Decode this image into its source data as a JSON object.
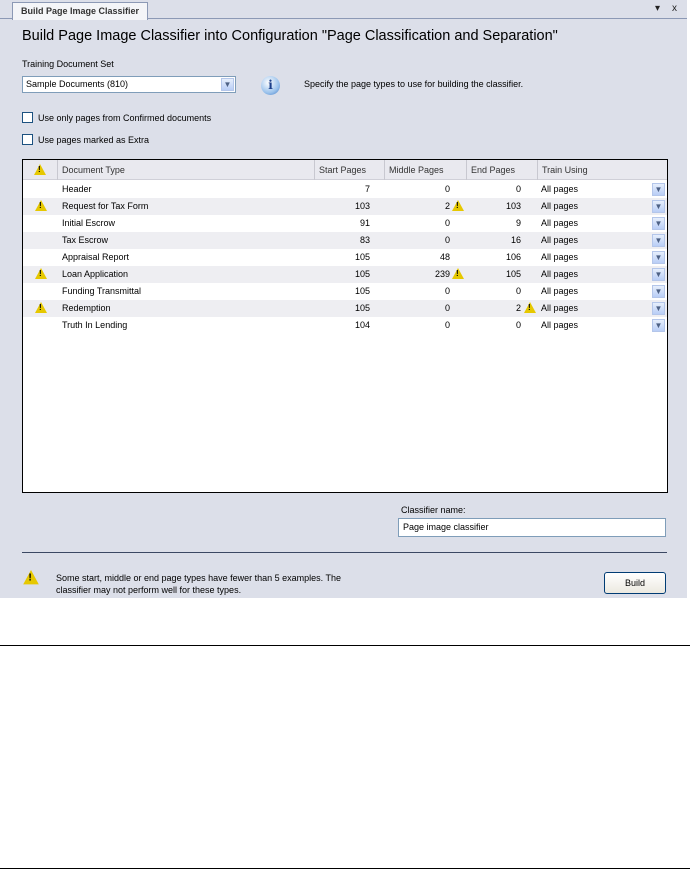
{
  "tab": {
    "label": "Build Page Image Classifier",
    "pin": "▾",
    "close": "x"
  },
  "title": "Build Page Image Classifier into Configuration \"Page Classification and Separation\"",
  "training_set": {
    "label": "Training Document Set",
    "value": "Sample Documents (810)"
  },
  "info_text": "Specify the page types to use for building the classifier.",
  "options": {
    "confirmed": "Use only pages from Confirmed documents",
    "extra": "Use pages marked as Extra"
  },
  "table": {
    "headers": [
      "Document Type",
      "Start Pages",
      "Middle Pages",
      "End Pages",
      "Train Using"
    ],
    "rows": [
      {
        "warn": false,
        "type": "Header",
        "start": "7",
        "middle": "0",
        "middle_warn": false,
        "end": "0",
        "end_warn": false,
        "train": "All pages"
      },
      {
        "warn": true,
        "type": "Request for Tax Form",
        "start": "103",
        "middle": "2",
        "middle_warn": true,
        "end": "103",
        "end_warn": false,
        "train": "All pages"
      },
      {
        "warn": false,
        "type": "Initial Escrow",
        "start": "91",
        "middle": "0",
        "middle_warn": false,
        "end": "9",
        "end_warn": false,
        "train": "All pages"
      },
      {
        "warn": false,
        "type": "Tax Escrow",
        "start": "83",
        "middle": "0",
        "middle_warn": false,
        "end": "16",
        "end_warn": false,
        "train": "All pages"
      },
      {
        "warn": false,
        "type": "Appraisal Report",
        "start": "105",
        "middle": "48",
        "middle_warn": false,
        "end": "106",
        "end_warn": false,
        "train": "All pages"
      },
      {
        "warn": true,
        "type": "Loan Application",
        "start": "105",
        "middle": "239",
        "middle_warn": true,
        "end": "105",
        "end_warn": false,
        "train": "All pages"
      },
      {
        "warn": false,
        "type": "Funding Transmittal",
        "start": "105",
        "middle": "0",
        "middle_warn": false,
        "end": "0",
        "end_warn": false,
        "train": "All pages"
      },
      {
        "warn": true,
        "type": "Redemption",
        "start": "105",
        "middle": "0",
        "middle_warn": false,
        "end": "2",
        "end_warn": true,
        "train": "All pages"
      },
      {
        "warn": false,
        "type": "Truth In Lending",
        "start": "104",
        "middle": "0",
        "middle_warn": false,
        "end": "0",
        "end_warn": false,
        "train": "All pages"
      }
    ]
  },
  "classifier": {
    "label": "Classifier name:",
    "value": "Page image classifier"
  },
  "warning": {
    "line1": "Some start, middle or end page types have fewer than 5 examples. The",
    "line2": "classifier may not perform well for these types."
  },
  "build_label": "Build"
}
